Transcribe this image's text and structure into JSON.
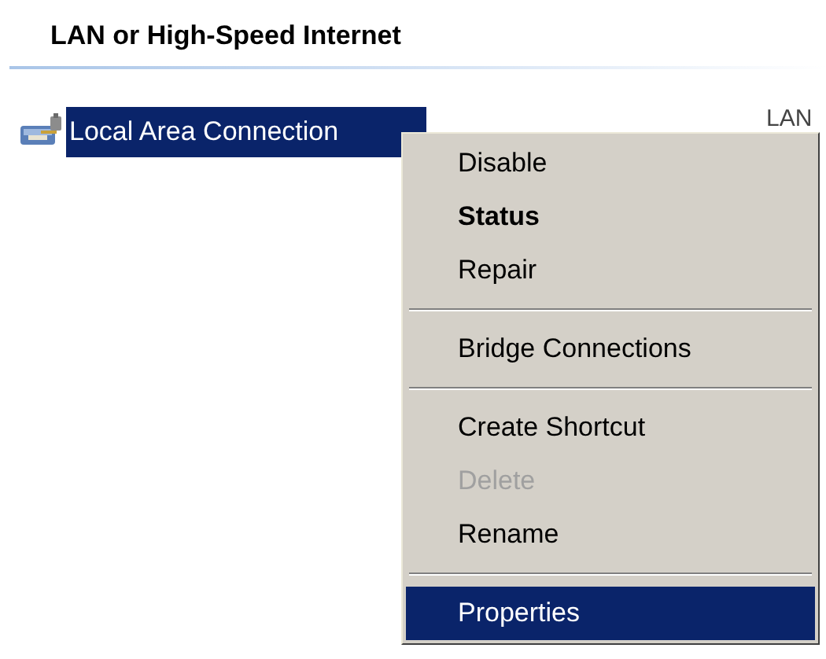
{
  "group": {
    "title": "LAN or High-Speed Internet"
  },
  "connections": [
    {
      "name": "Local Area Connection",
      "type": "LAN",
      "selected": true
    }
  ],
  "context_menu": {
    "items": [
      {
        "kind": "item",
        "label": "Disable",
        "default": false,
        "disabled": false,
        "selected": false
      },
      {
        "kind": "item",
        "label": "Status",
        "default": true,
        "disabled": false,
        "selected": false
      },
      {
        "kind": "item",
        "label": "Repair",
        "default": false,
        "disabled": false,
        "selected": false
      },
      {
        "kind": "separator"
      },
      {
        "kind": "item",
        "label": "Bridge Connections",
        "default": false,
        "disabled": false,
        "selected": false
      },
      {
        "kind": "separator"
      },
      {
        "kind": "item",
        "label": "Create Shortcut",
        "default": false,
        "disabled": false,
        "selected": false
      },
      {
        "kind": "item",
        "label": "Delete",
        "default": false,
        "disabled": true,
        "selected": false
      },
      {
        "kind": "item",
        "label": "Rename",
        "default": false,
        "disabled": false,
        "selected": false
      },
      {
        "kind": "separator"
      },
      {
        "kind": "item",
        "label": "Properties",
        "default": false,
        "disabled": false,
        "selected": true
      }
    ]
  }
}
